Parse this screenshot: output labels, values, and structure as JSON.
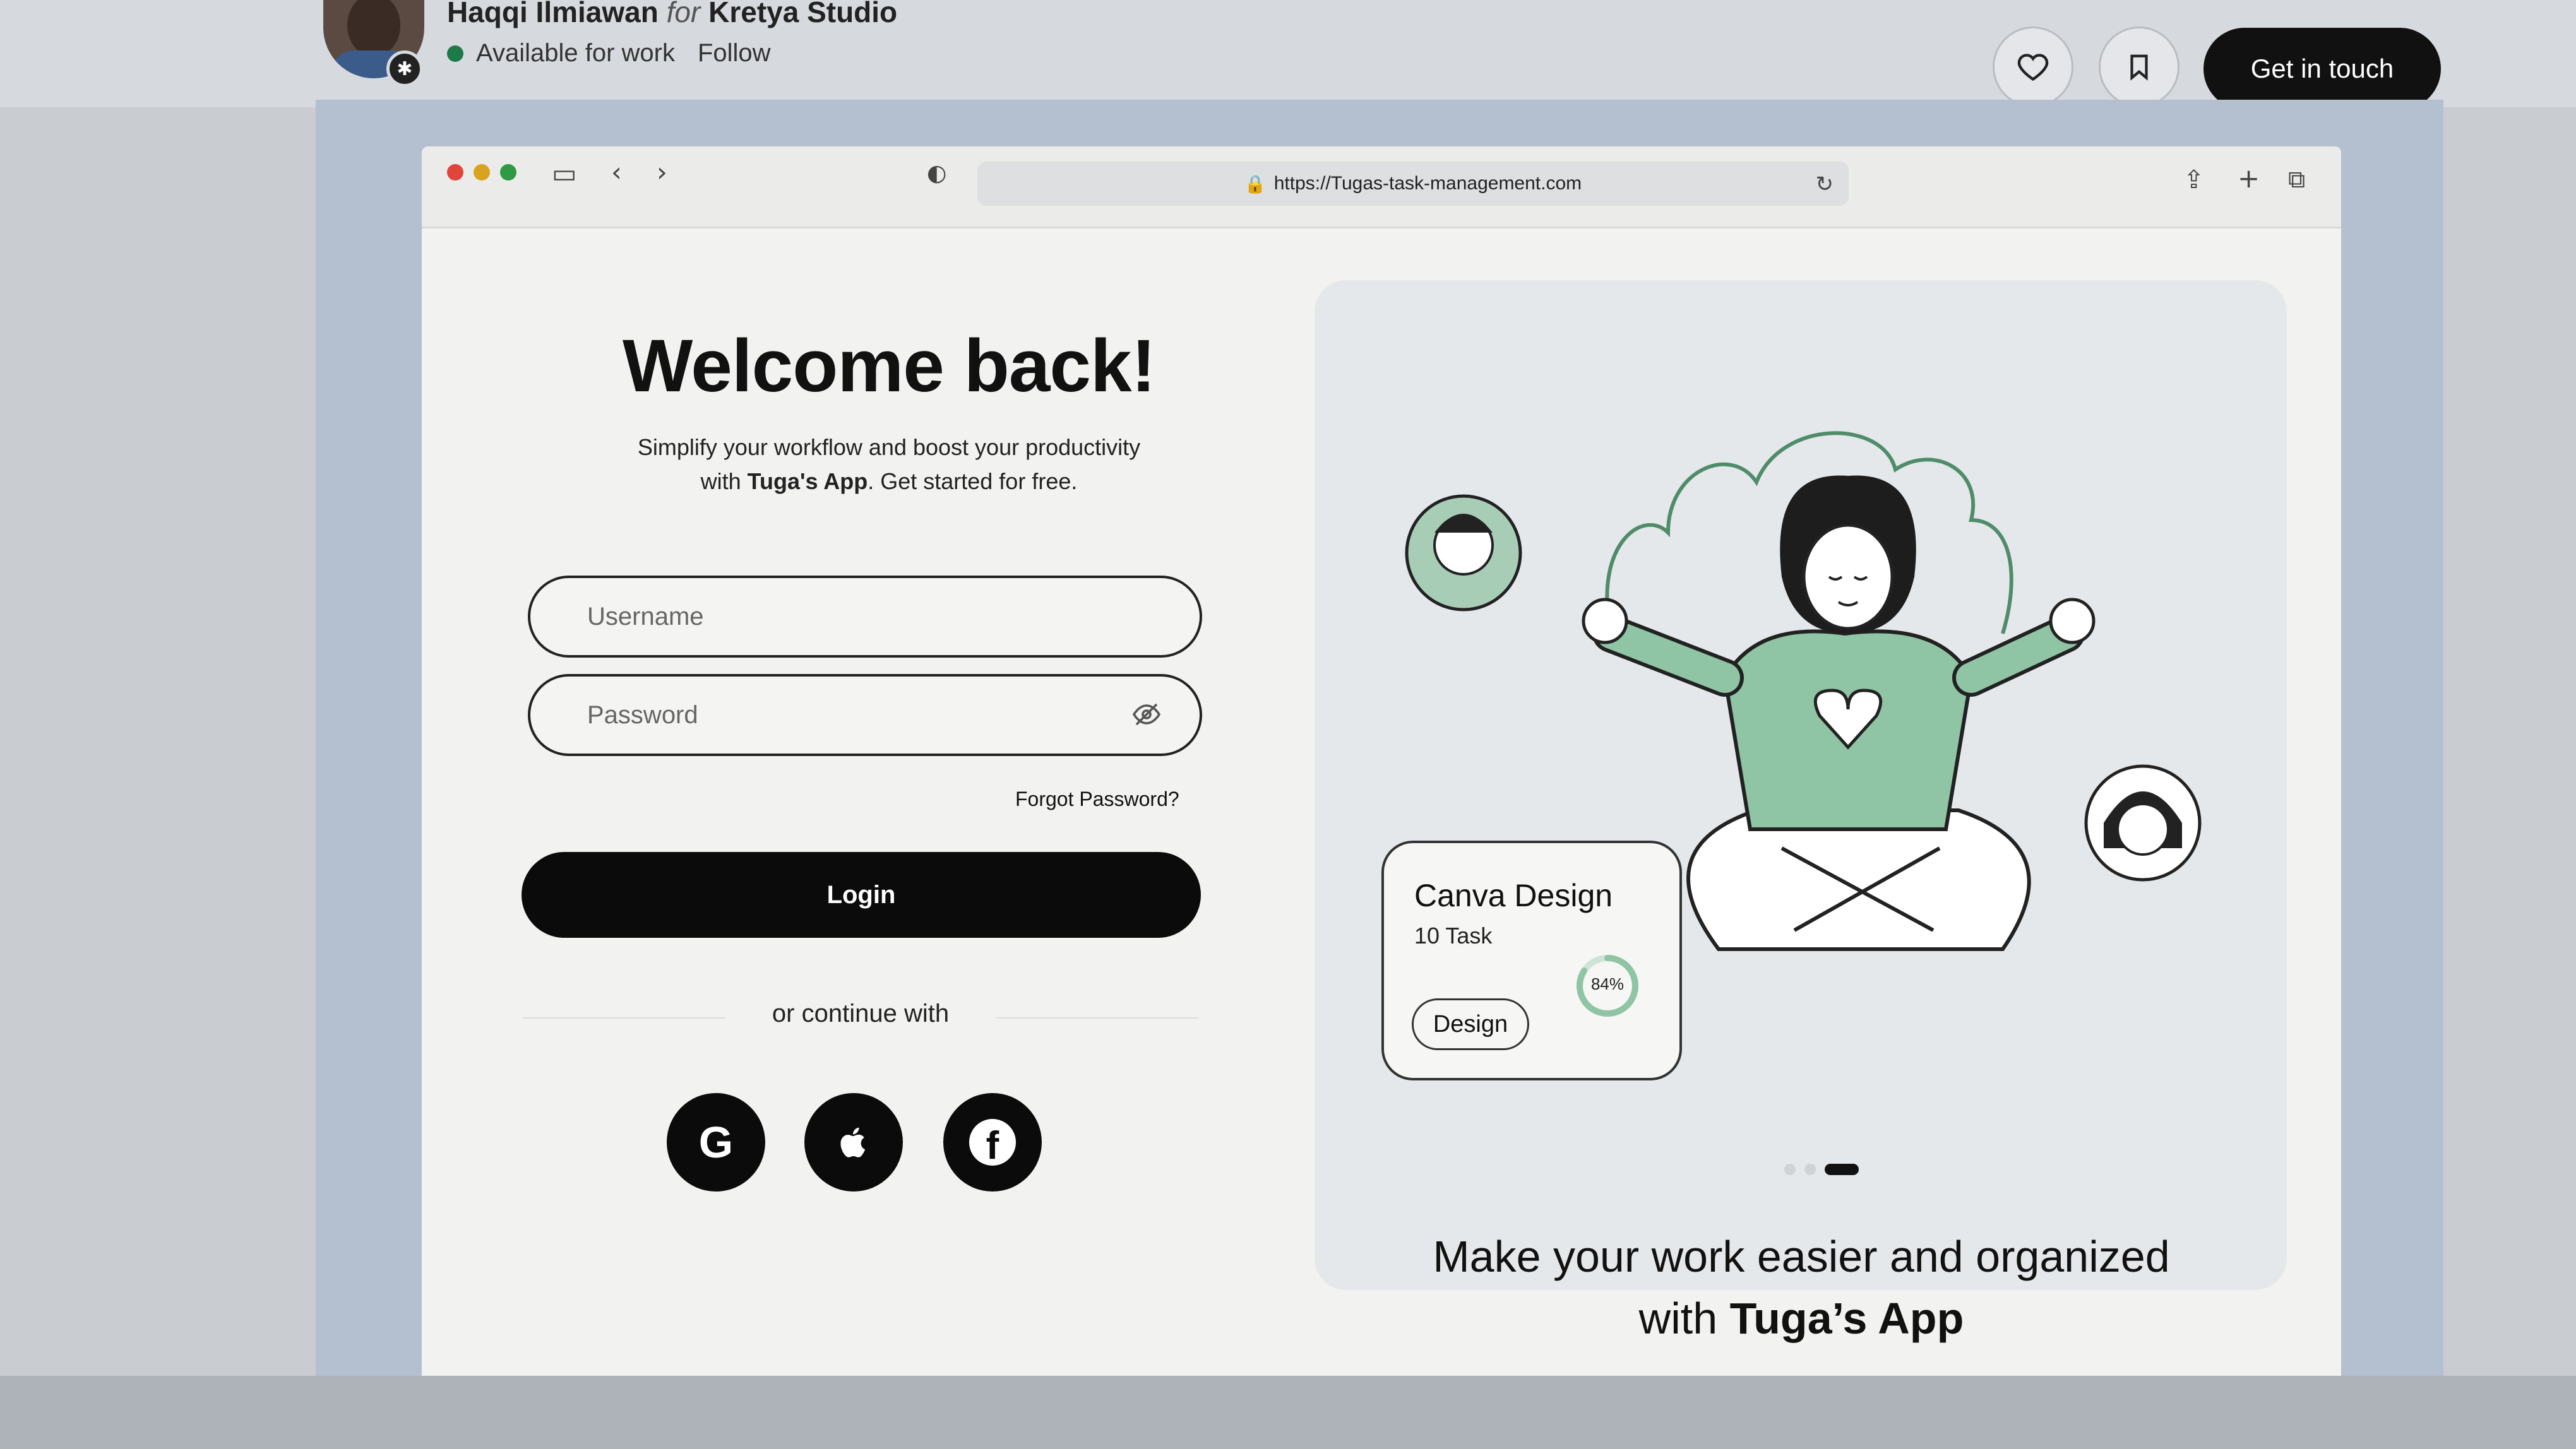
{
  "header": {
    "author": "Haqqi Ilmiawan",
    "for_word": "for",
    "studio": "Kretya Studio",
    "status": "Available for work",
    "follow": "Follow",
    "cta": "Get in touch",
    "like_icon": "heart-icon",
    "save_icon": "bookmark-icon"
  },
  "browser": {
    "url": "https://Tugas-task-management.com",
    "traffic_lights": [
      "#e0443a",
      "#d9a31f",
      "#2e9a44"
    ]
  },
  "login": {
    "title": "Welcome back!",
    "subtitle_line1": "Simplify your workflow and boost your productivity",
    "subtitle_line2_app": "Tuga's App",
    "subtitle_line2_pre": "with",
    "subtitle_line2_post": ". Get started for free.",
    "username_placeholder": "Username",
    "password_placeholder": "Password",
    "forgot": "Forgot Password?",
    "login_button": "Login",
    "or_continue": "or continue with",
    "social": [
      "G",
      "",
      "f"
    ]
  },
  "hero": {
    "card_title": "Canva Design",
    "card_tasks": "10 Task",
    "card_chip": "Design",
    "progress_label": "84%",
    "progress": 0.84,
    "carousel_active": 3,
    "carousel_count": 3,
    "tagline_line1": "Make your work easier and organized",
    "tagline_line2_pre": "with",
    "tagline_line2_app": "Tuga’s App",
    "accent_green": "#8fc4a5"
  }
}
